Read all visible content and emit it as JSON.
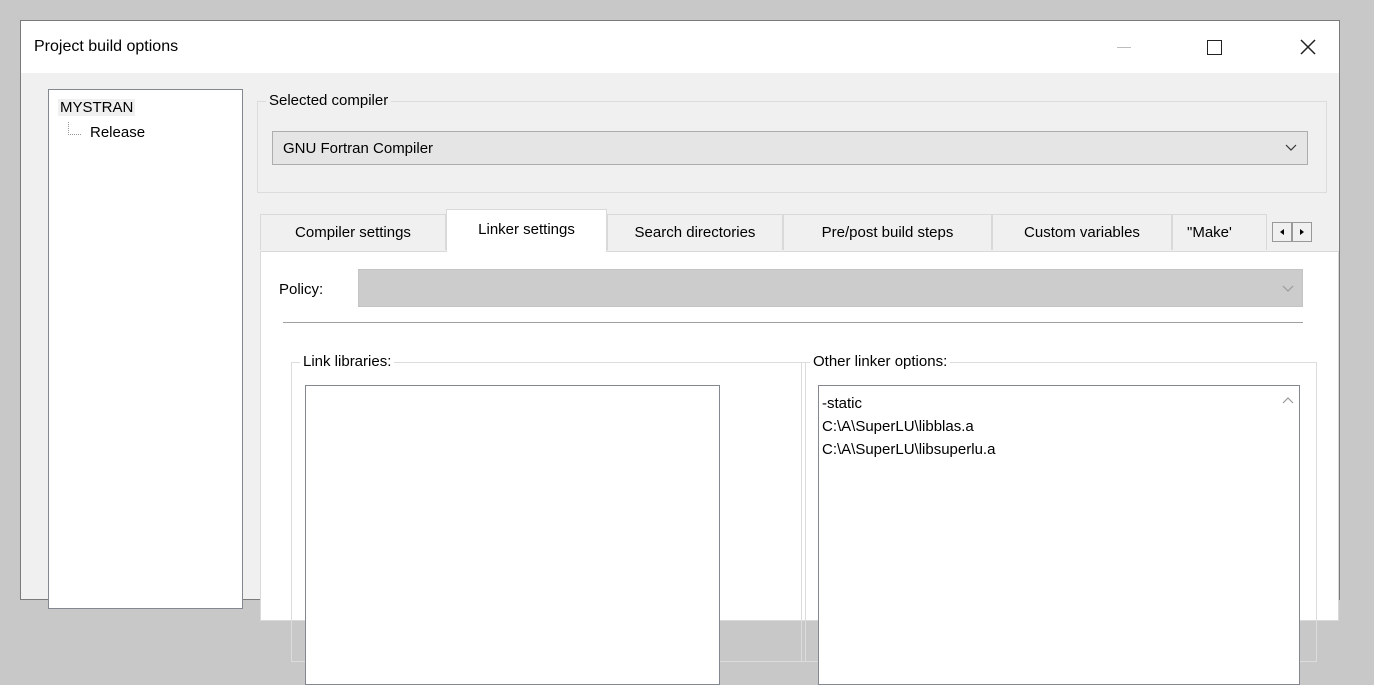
{
  "window": {
    "title": "Project build options"
  },
  "tree": {
    "root": "MYSTRAN",
    "children": [
      "Release"
    ]
  },
  "compiler": {
    "group_label": "Selected compiler",
    "selected": "GNU Fortran Compiler"
  },
  "tabs": [
    {
      "label": "Compiler settings"
    },
    {
      "label": "Linker settings",
      "active": true
    },
    {
      "label": "Search directories"
    },
    {
      "label": "Pre/post build steps"
    },
    {
      "label": "Custom variables"
    },
    {
      "label": "\"Make'"
    }
  ],
  "policy": {
    "label": "Policy:",
    "value": ""
  },
  "link_libraries": {
    "label": "Link libraries:",
    "items": []
  },
  "other_linker_options": {
    "label": "Other linker options:",
    "lines": [
      "-static",
      "C:\\A\\SuperLU\\libblas.a",
      "C:\\A\\SuperLU\\libsuperlu.a"
    ]
  },
  "icons": {
    "minimize": "minimize-icon",
    "maximize": "maximize-icon",
    "close": "close-icon",
    "dropdown": "chevron-down-icon",
    "scroll_left": "arrow-left-icon",
    "scroll_right": "arrow-right-icon",
    "scroll_up": "chevron-up-icon"
  }
}
